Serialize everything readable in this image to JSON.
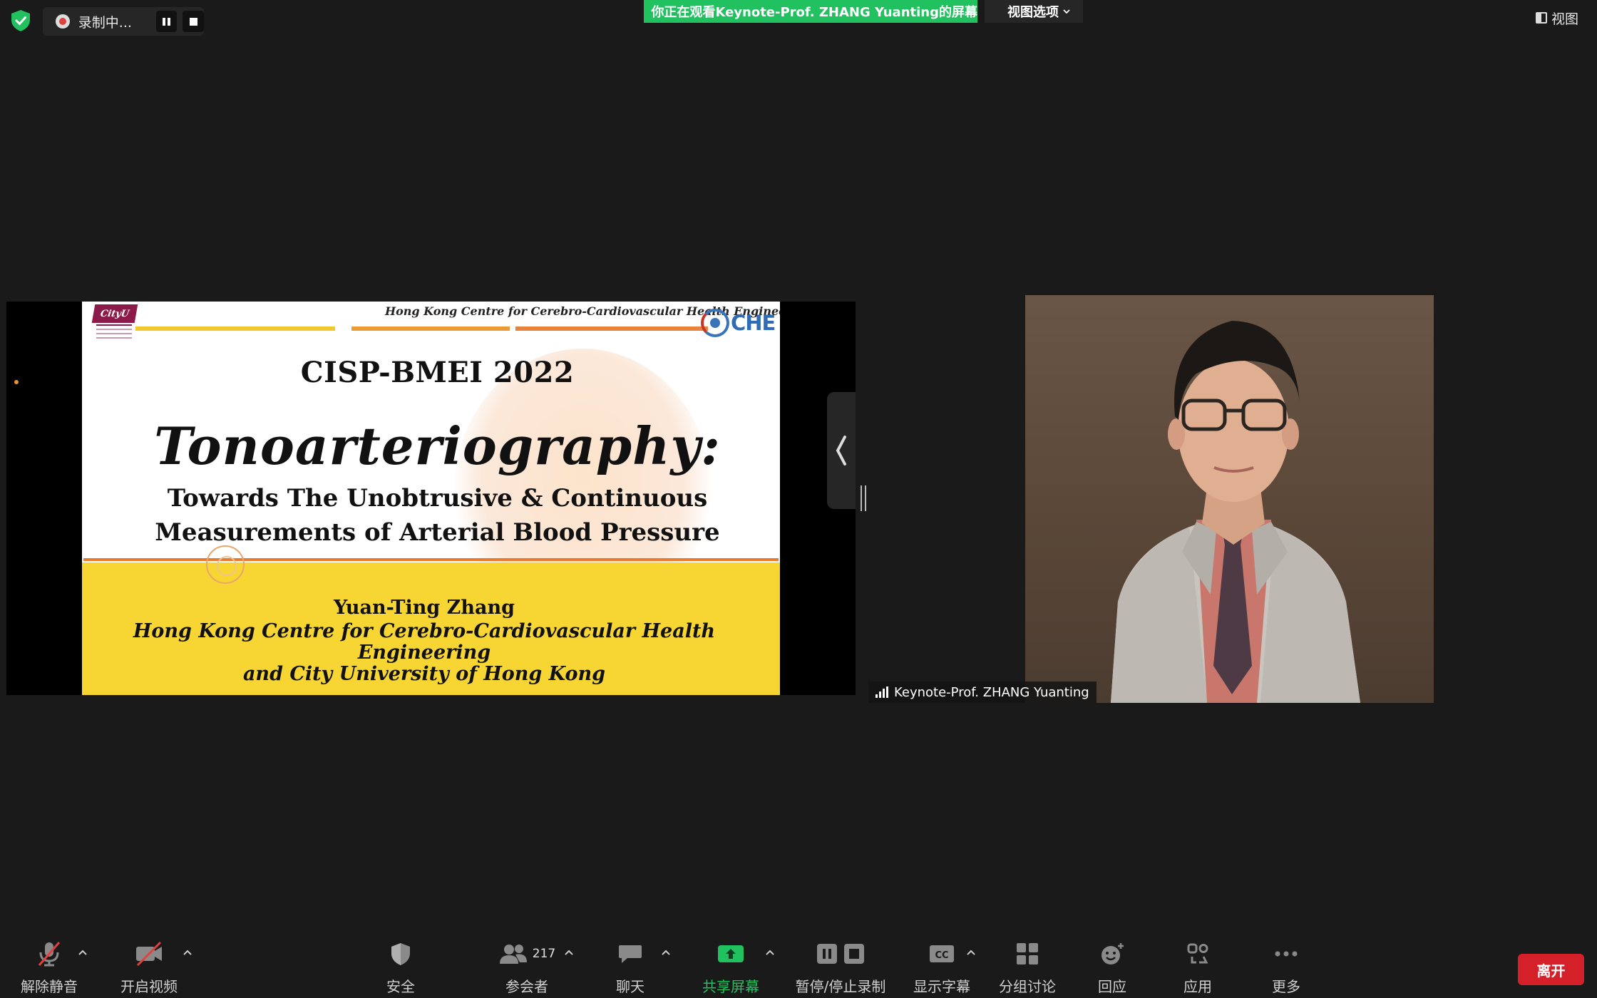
{
  "top_bar": {
    "recording_label": "录制中...",
    "viewing_banner": "你正在观看Keynote-Prof.  ZHANG  Yuanting的屏幕",
    "view_options_label": "视图选项",
    "view_label": "视图"
  },
  "slide": {
    "header_text": "Hong Kong Centre for Cerebro-Cardiovascular Health Engineering",
    "cityu_badge": "CityU",
    "che_logo_text": "CHE",
    "conference": "CISP-BMEI 2022",
    "title": "Tonoarteriography:",
    "subtitle_line1": "Towards The Unobtrusive & Continuous",
    "subtitle_line2": "Measurements of Arterial Blood Pressure",
    "author": "Yuan-Ting Zhang",
    "affiliation_line1": "Hong Kong Centre for Cerebro-Cardiovascular Health Engineering",
    "affiliation_line2": "and City University of Hong Kong"
  },
  "video": {
    "participant_name": "Keynote-Prof. ZHANG Yuanting"
  },
  "toolbar": {
    "unmute": "解除静音",
    "start_video": "开启视频",
    "security": "安全",
    "participants": "参会者",
    "participant_count": "217",
    "chat": "聊天",
    "share_screen": "共享屏幕",
    "pause_stop_recording": "暂停/停止录制",
    "captions": "显示字幕",
    "captions_icon_text": "CC",
    "breakout": "分组讨论",
    "reactions": "回应",
    "apps": "应用",
    "more": "更多",
    "leave": "离开"
  },
  "colors": {
    "background": "#1a1a1a",
    "accent_green": "#21c160",
    "leave_red": "#d32029",
    "slide_yellow": "#f7d533"
  }
}
